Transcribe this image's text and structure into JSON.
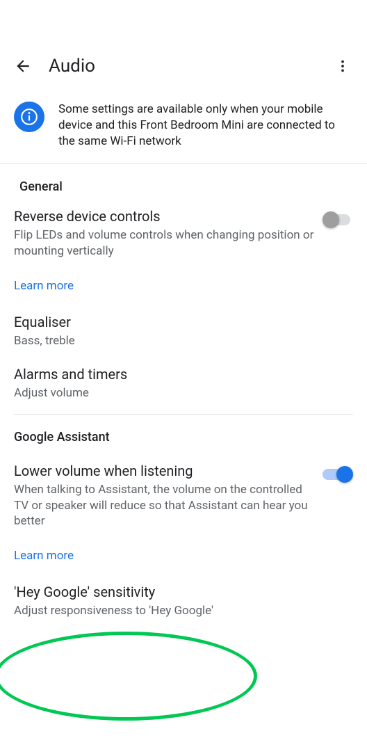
{
  "header": {
    "title": "Audio"
  },
  "banner": {
    "text": "Some settings are available only when your mobile device and this Front Bedroom Mini are connected to the same Wi-Fi network"
  },
  "sections": {
    "general": {
      "label": "General",
      "reverse": {
        "title": "Reverse device controls",
        "sub": "Flip LEDs and volume controls when changing position or mounting vertically"
      },
      "learn_more": "Learn more",
      "equaliser": {
        "title": "Equaliser",
        "sub": "Bass, treble"
      },
      "alarms": {
        "title": "Alarms and timers",
        "sub": "Adjust volume"
      }
    },
    "assistant": {
      "label": "Google Assistant",
      "lower_volume": {
        "title": "Lower volume when listening",
        "sub": "When talking to Assistant, the volume on the controlled TV or speaker will reduce so that Assistant can hear you better"
      },
      "learn_more": "Learn more",
      "sensitivity": {
        "title": "'Hey Google' sensitivity",
        "sub": "Adjust responsiveness to 'Hey Google'"
      }
    }
  }
}
